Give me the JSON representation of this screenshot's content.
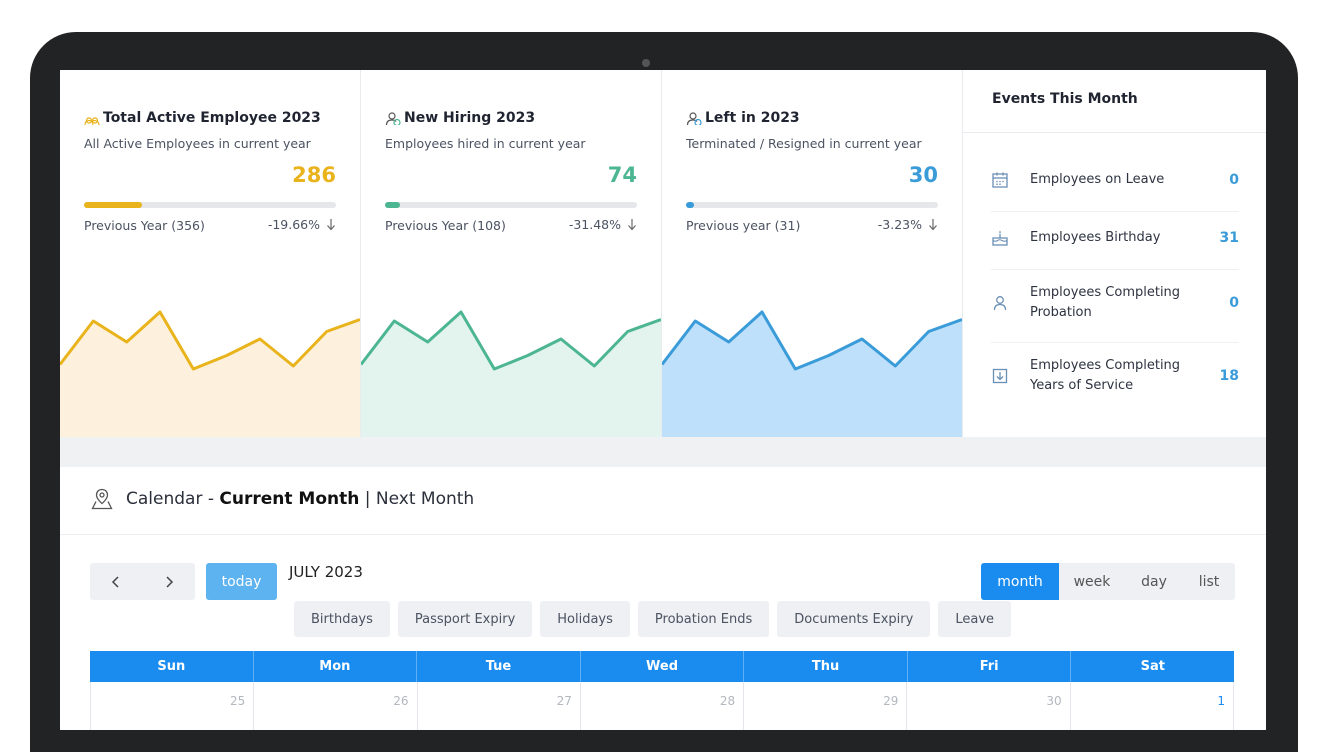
{
  "cards": [
    {
      "title": "Total Active Employee 2023",
      "subtitle": "All Active Employees in current year",
      "value": "286",
      "progress": 0.23,
      "previous": "Previous Year (356)",
      "change": "-19.66%",
      "color": "#e9b31c",
      "fill": "#fdf1dd",
      "icon": "users-icon",
      "spark": [
        0.3,
        0.88,
        0.6,
        1.0,
        0.24,
        0.42,
        0.64,
        0.28,
        0.74,
        0.9
      ]
    },
    {
      "title": "New Hiring 2023",
      "subtitle": "Employees hired in current year",
      "value": "74",
      "progress": 0.06,
      "previous": "Previous Year (108)",
      "change": "-31.48%",
      "color": "#4cb592",
      "fill": "#e3f3ee",
      "icon": "user-add-icon",
      "spark": [
        0.3,
        0.88,
        0.6,
        1.0,
        0.24,
        0.42,
        0.64,
        0.28,
        0.74,
        0.9
      ]
    },
    {
      "title": "Left in 2023",
      "subtitle": "Terminated / Resigned in current year",
      "value": "30",
      "progress": 0.03,
      "previous": "Previous year (31)",
      "change": "-3.23%",
      "color": "#3a9bd9",
      "fill": "#bfe0fa",
      "icon": "user-remove-icon",
      "spark": [
        0.3,
        0.88,
        0.6,
        1.0,
        0.24,
        0.42,
        0.64,
        0.28,
        0.74,
        0.9
      ]
    }
  ],
  "events": {
    "title": "Events This Month",
    "items": [
      {
        "label": "Employees on Leave",
        "count": "0",
        "icon": "calendar-icon"
      },
      {
        "label": "Employees Birthday",
        "count": "31",
        "icon": "cake-icon"
      },
      {
        "label": "Employees Completing Probation",
        "count": "0",
        "icon": "person-icon"
      },
      {
        "label": "Employees Completing Years of Service",
        "count": "18",
        "icon": "download-icon"
      }
    ]
  },
  "calendar": {
    "header_prefix": "Calendar - ",
    "current_label": "Current Month",
    "separator": " | ",
    "next_label": "Next Month",
    "today_label": "today",
    "month_title": "JULY 2023",
    "views": [
      "month",
      "week",
      "day",
      "list"
    ],
    "active_view": "month",
    "filters": [
      "Birthdays",
      "Passport Expiry",
      "Holidays",
      "Probation Ends",
      "Documents Expiry",
      "Leave"
    ],
    "day_names": [
      "Sun",
      "Mon",
      "Tue",
      "Wed",
      "Thu",
      "Fri",
      "Sat"
    ],
    "first_row": [
      "25",
      "26",
      "27",
      "28",
      "29",
      "30",
      "1"
    ]
  }
}
